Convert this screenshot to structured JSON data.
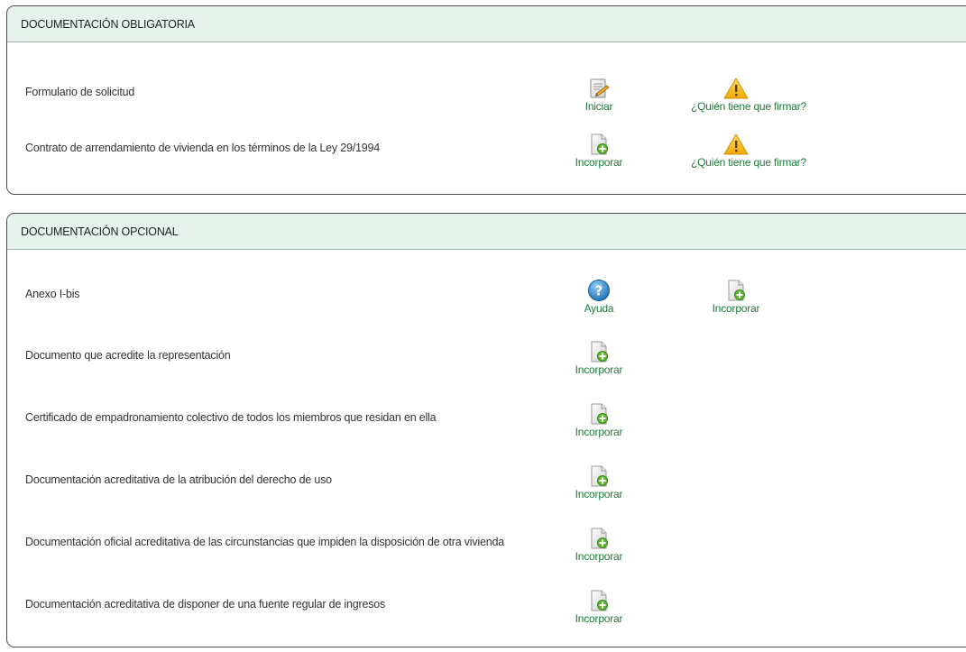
{
  "obligatoria": {
    "title": "DOCUMENTACIÓN OBLIGATORIA",
    "rows": [
      {
        "label": "Formulario de solicitud",
        "action1": {
          "icon": "edit-form-icon",
          "label": "Iniciar"
        },
        "action2": {
          "icon": "warning-icon",
          "label": "¿Quién tiene que firmar?"
        }
      },
      {
        "label": "Contrato de arrendamiento de vivienda en los términos de la Ley 29/1994",
        "action1": {
          "icon": "add-document-icon",
          "label": "Incorporar"
        },
        "action2": {
          "icon": "warning-icon",
          "label": "¿Quién tiene que firmar?"
        }
      }
    ]
  },
  "opcional": {
    "title": "DOCUMENTACIÓN OPCIONAL",
    "rows": [
      {
        "label": "Anexo I-bis",
        "action1": {
          "icon": "help-icon",
          "label": "Ayuda"
        },
        "action2": {
          "icon": "add-document-icon",
          "label": "Incorporar"
        }
      },
      {
        "label": "Documento que acredite la representación",
        "action1": {
          "icon": "add-document-icon",
          "label": "Incorporar"
        }
      },
      {
        "label": "Certificado de empadronamiento colectivo de todos los miembros que residan en ella",
        "action1": {
          "icon": "add-document-icon",
          "label": "Incorporar"
        }
      },
      {
        "label": "Documentación acreditativa de la atribución del derecho de uso",
        "action1": {
          "icon": "add-document-icon",
          "label": "Incorporar"
        }
      },
      {
        "label": "Documentación oficial acreditativa de las circunstancias que impiden la disposición de otra vivienda",
        "action1": {
          "icon": "add-document-icon",
          "label": "Incorporar"
        }
      },
      {
        "label": "Documentación acreditativa de disponer de una fuente regular de ingresos",
        "action1": {
          "icon": "add-document-icon",
          "label": "Incorporar"
        }
      }
    ]
  },
  "colors": {
    "header_bg": "#e8f2ec",
    "link_green": "#1f7a3a",
    "warning": "#f5b800",
    "help_blue": "#1f7fc0"
  }
}
